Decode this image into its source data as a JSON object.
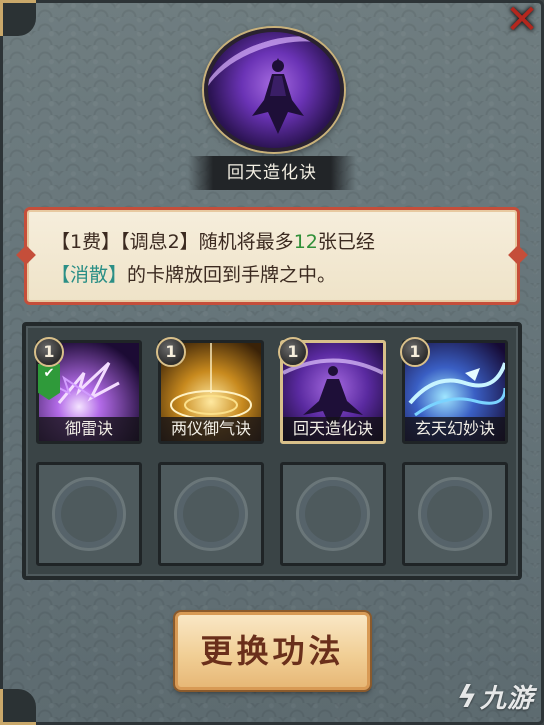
{
  "close_icon": "close-icon",
  "skill": {
    "title": "回天造化诀",
    "desc_line1": [
      "【1费】【调息2】随机将最多",
      "12",
      "张已经"
    ],
    "desc_line2": [
      "【消散】",
      "的卡牌放回到手牌之中。"
    ]
  },
  "cards": [
    {
      "cost": "1",
      "label": "御雷诀",
      "equipped": true,
      "selected": false,
      "art": "purple-lightning"
    },
    {
      "cost": "1",
      "label": "两仪御气诀",
      "equipped": false,
      "selected": false,
      "art": "golden-taiji"
    },
    {
      "cost": "1",
      "label": "回天造化诀",
      "equipped": false,
      "selected": true,
      "art": "purple-figure"
    },
    {
      "cost": "1",
      "label": "玄天幻妙诀",
      "equipped": false,
      "selected": false,
      "art": "blue-dragon"
    }
  ],
  "empty_slots": 4,
  "swap_button_label": "更换功法",
  "watermark": "九游",
  "colors": {
    "accent_red": "#c54e3a",
    "highlight_green": "#2f8f38",
    "button_text": "#6a2f1b"
  }
}
